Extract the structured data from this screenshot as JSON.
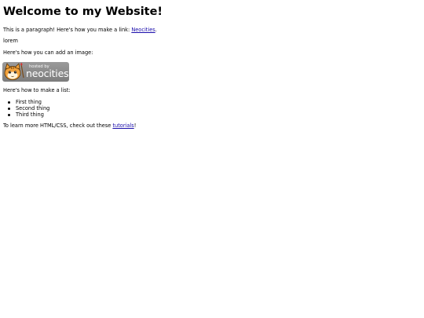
{
  "page": {
    "heading": "Welcome to my Website!",
    "paragraph": {
      "before": "This is a paragraph! Here's how you make a link: ",
      "link_text": "Neocities",
      "after": "."
    },
    "lorem": "lorem",
    "image_intro": "Here's how you can add an image:",
    "image": {
      "alt": "Hosted by Neocities",
      "small_text": "hosted by",
      "big_text": "neocities"
    },
    "list_intro": "Here's how to make a list:",
    "list_items": [
      "First thing",
      "Second thing",
      "Third thing"
    ],
    "footer": {
      "before": "To learn more HTML/CSS, check out these ",
      "link_text": "tutorials",
      "after": "!"
    }
  },
  "colors": {
    "link": "#1a0dab",
    "badge_background": "#8c8c8c",
    "text": "#000000"
  }
}
